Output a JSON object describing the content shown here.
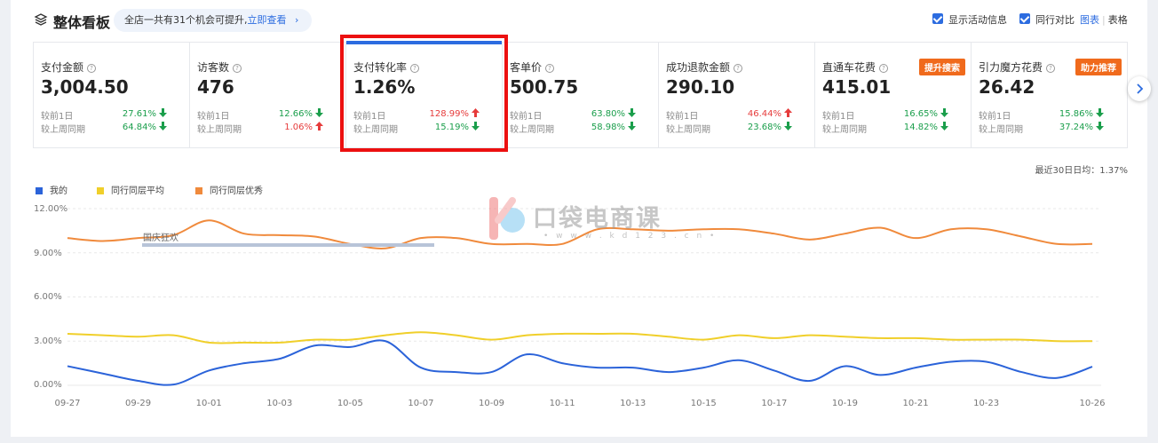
{
  "header": {
    "title": "整体看板",
    "hint_text": "全店一共有31个机会可提升,",
    "hint_link": "立即查看",
    "show_activity_label": "显示活动信息",
    "peer_compare_label": "同行对比",
    "view_chart": "图表",
    "view_table": "表格"
  },
  "cards": [
    {
      "name": "支付金额",
      "value": "3,004.50",
      "r1_label": "较前1日",
      "r1_pct": "27.61%",
      "r1_dir": "down",
      "r2_label": "较上周同期",
      "r2_pct": "64.84%",
      "r2_dir": "down"
    },
    {
      "name": "访客数",
      "value": "476",
      "r1_label": "较前1日",
      "r1_pct": "12.66%",
      "r1_dir": "down",
      "r2_label": "较上周同期",
      "r2_pct": "1.06%",
      "r2_dir": "up"
    },
    {
      "name": "支付转化率",
      "value": "1.26%",
      "r1_label": "较前1日",
      "r1_pct": "128.99%",
      "r1_dir": "up",
      "r2_label": "较上周同期",
      "r2_pct": "15.19%",
      "r2_dir": "down"
    },
    {
      "name": "客单价",
      "value": "500.75",
      "r1_label": "较前1日",
      "r1_pct": "63.80%",
      "r1_dir": "down",
      "r2_label": "较上周同期",
      "r2_pct": "58.98%",
      "r2_dir": "down"
    },
    {
      "name": "成功退款金额",
      "value": "290.10",
      "r1_label": "较前1日",
      "r1_pct": "46.44%",
      "r1_dir": "up",
      "r2_label": "较上周同期",
      "r2_pct": "23.68%",
      "r2_dir": "down"
    },
    {
      "name": "直通车花费",
      "value": "415.01",
      "tag": "提升搜索",
      "r1_label": "较前1日",
      "r1_pct": "16.65%",
      "r1_dir": "down",
      "r2_label": "较上周同期",
      "r2_pct": "14.82%",
      "r2_dir": "down"
    },
    {
      "name": "引力魔方花费",
      "value": "26.42",
      "tag": "助力推荐",
      "r1_label": "较前1日",
      "r1_pct": "15.86%",
      "r1_dir": "down",
      "r2_label": "较上周同期",
      "r2_pct": "37.24%",
      "r2_dir": "down"
    }
  ],
  "avg_note": "最近30日日均：1.37%",
  "event": {
    "label": "国庆狂欢"
  },
  "watermark": {
    "text": "口袋电商课",
    "url": "• w w w . k d 1 2 3 . c n •"
  },
  "colors": {
    "accent": "#2c6ce0",
    "up": "#e63b3b",
    "down": "#1a9e4b",
    "mine": "#2b63d9",
    "avg": "#f0cf2a",
    "top": "#f08a3c",
    "highlight": "#ec1010"
  },
  "chart_data": {
    "type": "line",
    "x": [
      "09-27",
      "09-28",
      "09-29",
      "09-30",
      "10-01",
      "10-02",
      "10-03",
      "10-04",
      "10-05",
      "10-06",
      "10-07",
      "10-08",
      "10-09",
      "10-10",
      "10-11",
      "10-12",
      "10-13",
      "10-14",
      "10-15",
      "10-16",
      "10-17",
      "10-18",
      "10-19",
      "10-20",
      "10-21",
      "10-22",
      "10-23",
      "10-24",
      "10-25",
      "10-26"
    ],
    "x_ticks": [
      "09-27",
      "09-29",
      "10-01",
      "10-03",
      "10-05",
      "10-07",
      "10-09",
      "10-11",
      "10-13",
      "10-15",
      "10-17",
      "10-19",
      "10-21",
      "10-23",
      "10-26"
    ],
    "y_ticks": [
      "0.00%",
      "3.00%",
      "6.00%",
      "9.00%",
      "12.00%"
    ],
    "ylim": [
      0,
      12
    ],
    "legend_position": "top-left",
    "series": [
      {
        "name": "我的",
        "color": "#2b63d9",
        "values": [
          1.3,
          0.8,
          0.3,
          0.05,
          1.0,
          1.5,
          1.8,
          2.7,
          2.6,
          3.0,
          1.2,
          0.9,
          0.9,
          2.1,
          1.5,
          1.2,
          1.2,
          0.9,
          1.2,
          1.7,
          1.0,
          0.3,
          1.3,
          0.7,
          1.2,
          1.6,
          1.6,
          0.9,
          0.5,
          1.26
        ]
      },
      {
        "name": "同行同层平均",
        "color": "#f0cf2a",
        "values": [
          3.5,
          3.4,
          3.3,
          3.4,
          2.9,
          2.9,
          2.9,
          3.1,
          3.1,
          3.4,
          3.6,
          3.4,
          3.1,
          3.4,
          3.5,
          3.5,
          3.5,
          3.3,
          3.1,
          3.4,
          3.2,
          3.4,
          3.3,
          3.2,
          3.2,
          3.1,
          3.1,
          3.1,
          3.0,
          3.0
        ]
      },
      {
        "name": "同行同层优秀",
        "color": "#f08a3c",
        "values": [
          10.0,
          9.8,
          10.0,
          10.2,
          11.2,
          10.3,
          10.2,
          10.1,
          9.6,
          9.3,
          10.0,
          10.0,
          9.6,
          9.6,
          9.6,
          10.6,
          10.6,
          10.5,
          10.6,
          10.6,
          10.3,
          9.9,
          10.3,
          10.7,
          10.0,
          10.6,
          10.6,
          10.1,
          9.6,
          9.6
        ]
      }
    ]
  }
}
